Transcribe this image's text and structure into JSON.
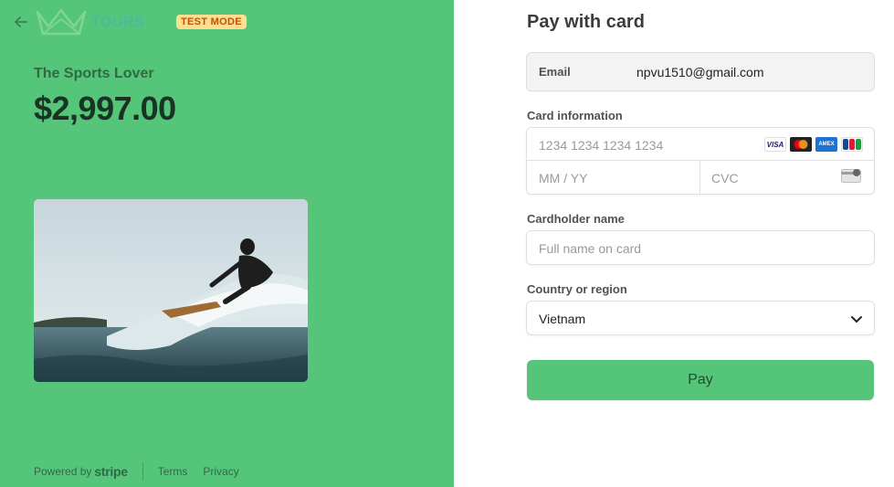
{
  "left": {
    "brand": "TOURS",
    "badge": "TEST MODE",
    "product": "The Sports Lover",
    "price": "$2,997.00",
    "footer": {
      "powered": "Powered by",
      "stripe": "stripe",
      "terms": "Terms",
      "privacy": "Privacy"
    }
  },
  "form": {
    "title": "Pay with card",
    "email_label": "Email",
    "email_value": "npvu1510@gmail.com",
    "card_label": "Card information",
    "card_number_placeholder": "1234 1234 1234 1234",
    "expiry_placeholder": "MM / YY",
    "cvc_placeholder": "CVC",
    "card_brands": [
      "VISA",
      "mastercard",
      "AMEX",
      "JCB"
    ],
    "name_label": "Cardholder name",
    "name_placeholder": "Full name on card",
    "country_label": "Country or region",
    "country_value": "Vietnam",
    "pay_label": "Pay"
  },
  "colors": {
    "panel": "#55c57a",
    "badge_bg": "#ffde92",
    "badge_text": "#bb5504"
  }
}
